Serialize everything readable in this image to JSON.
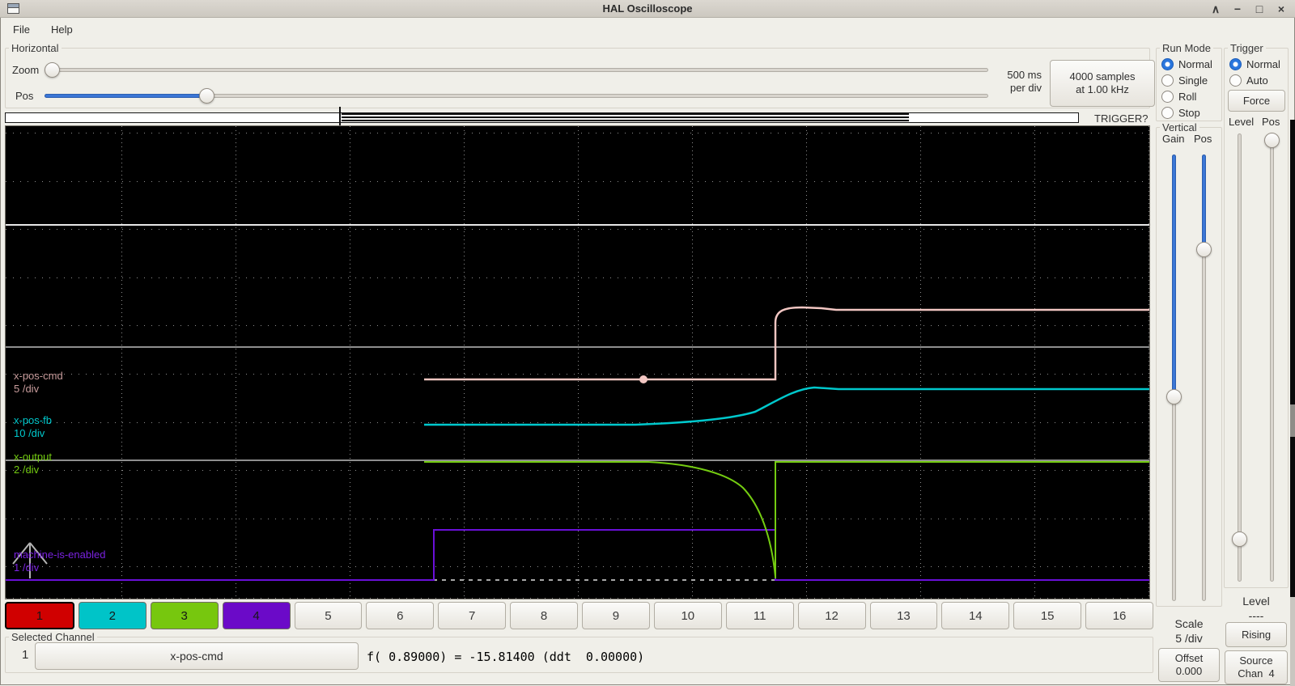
{
  "window": {
    "title": "HAL Oscilloscope",
    "icons": {
      "shade": "∧",
      "minimize": "−",
      "maximize": "□",
      "close": "×"
    }
  },
  "menu": {
    "items": [
      "File",
      "Help"
    ]
  },
  "horizontal": {
    "frame_label": "Horizontal",
    "zoom_label": "Zoom",
    "pos_label": "Pos",
    "per_div_line1": "500 ms",
    "per_div_line2": "per div",
    "samples_line1": "4000 samples",
    "samples_line2": "at 1.00 kHz"
  },
  "record_bar": {
    "trigger_status": "TRIGGER?"
  },
  "run_mode": {
    "frame_label": "Run Mode",
    "selected": "Normal",
    "options": [
      "Normal",
      "Single",
      "Roll",
      "Stop"
    ]
  },
  "trigger_panel": {
    "frame_label": "Trigger",
    "selected": "Normal",
    "options": [
      "Normal",
      "Auto"
    ],
    "force_button": "Force",
    "level_label": "Level",
    "pos_label": "Pos",
    "level_value": "----",
    "rising_button": "Rising",
    "source_label": "Source",
    "source_value": "Chan  4"
  },
  "vertical_panel": {
    "frame_label": "Vertical",
    "gain_label": "Gain",
    "pos_label": "Pos",
    "scale_label": "Scale",
    "scale_value": "5 /div",
    "offset_label": "Offset",
    "offset_value": "0.000"
  },
  "scope": {
    "channels": [
      {
        "name": "x-pos-cmd",
        "scale": "5 /div",
        "label_color": "#c89c9c",
        "trace_color": "#f2c6c2"
      },
      {
        "name": "x-pos-fb",
        "scale": "10 /div",
        "label_color": "#00c8cc",
        "trace_color": "#00c8cc"
      },
      {
        "name": "x-output",
        "scale": "2 /div",
        "label_color": "#74cc11",
        "trace_color": "#74cc11"
      },
      {
        "name": "machine-is-enabled",
        "scale": "1 /div",
        "label_color": "#7a22e0",
        "trace_color": "#6a10d8"
      }
    ]
  },
  "channel_selector": {
    "buttons": [
      {
        "label": "1",
        "color": "#d00000",
        "selected": true
      },
      {
        "label": "2",
        "color": "#00c4c8"
      },
      {
        "label": "3",
        "color": "#77c70e"
      },
      {
        "label": "4",
        "color": "#6b0ac8"
      },
      {
        "label": "5"
      },
      {
        "label": "6"
      },
      {
        "label": "7"
      },
      {
        "label": "8"
      },
      {
        "label": "9"
      },
      {
        "label": "10"
      },
      {
        "label": "11"
      },
      {
        "label": "12"
      },
      {
        "label": "13"
      },
      {
        "label": "14"
      },
      {
        "label": "15"
      },
      {
        "label": "16"
      }
    ]
  },
  "selected_channel": {
    "frame_label": "Selected Channel",
    "number": "1",
    "name": "x-pos-cmd",
    "readout": "f( 0.89000) = -15.81400 (ddt  0.00000)"
  }
}
